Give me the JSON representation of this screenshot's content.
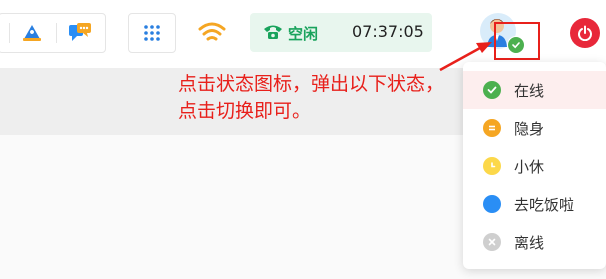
{
  "status_pill": {
    "label": "空闲",
    "time": "07:37:05"
  },
  "annotation": {
    "line1": "点击状态图标，弹出以下状态，",
    "line2": "点击切换即可。"
  },
  "status_menu": {
    "items": [
      {
        "label": "在线",
        "color": "#4cb04f",
        "icon": "check-icon",
        "active": true
      },
      {
        "label": "隐身",
        "color": "#f5a623",
        "icon": "equals-icon",
        "active": false
      },
      {
        "label": "小休",
        "color": "#fcd84a",
        "icon": "clock-icon",
        "active": false
      },
      {
        "label": "去吃饭啦",
        "color": "#2a8ef5",
        "icon": "dot-icon",
        "active": false
      },
      {
        "label": "离线",
        "color": "#cfcfcf",
        "icon": "x-icon",
        "active": false
      }
    ]
  },
  "colors": {
    "accent_red": "#e8201b",
    "online_green": "#4cb04f",
    "power_red": "#e8283a"
  }
}
